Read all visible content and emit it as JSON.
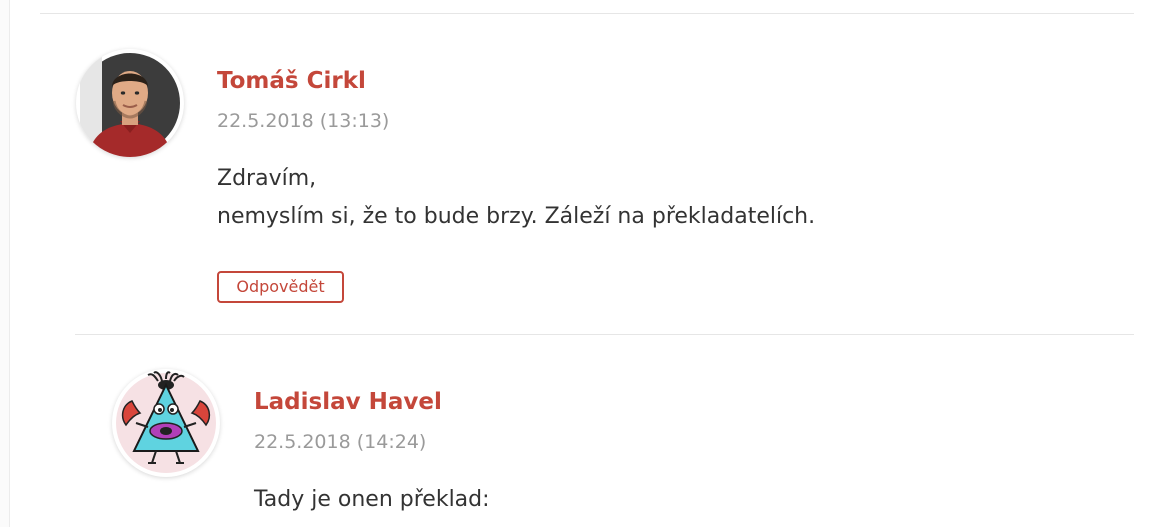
{
  "comments": [
    {
      "author": "Tomáš Cirkl",
      "date": "22.5.2018 (13:13)",
      "lines": [
        "Zdravím,",
        "nemyslím si, že to bude brzy. Záleží na překladatelích."
      ],
      "reply_label": "Odpovědět"
    },
    {
      "author": "Ladislav Havel",
      "date": "22.5.2018 (14:24)",
      "lines": [
        "Tady je onen překlad:"
      ]
    }
  ],
  "colors": {
    "accent": "#c4473a",
    "meta": "#9a9a9a",
    "text": "#333333"
  }
}
